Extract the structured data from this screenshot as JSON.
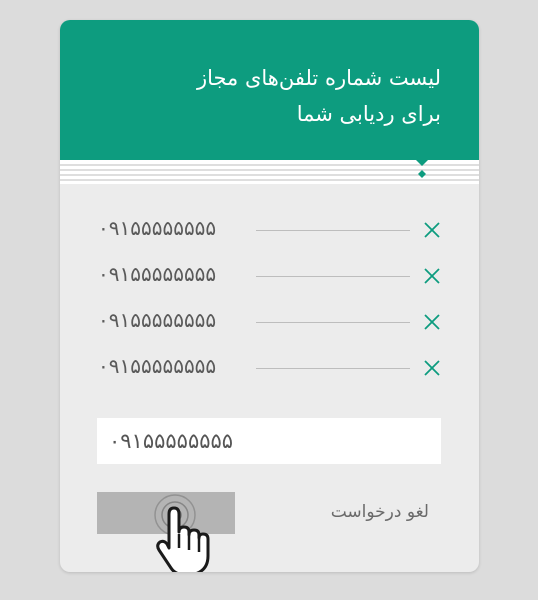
{
  "header": {
    "title_line1": "لیست شماره تلفن‌های مجاز",
    "title_line2": "برای ردیابی شما",
    "background": "#0d9c7f"
  },
  "numbers": [
    {
      "value": "۰۹۱۵۵۵۵۵۵۵۵",
      "delete_icon": "close-icon"
    },
    {
      "value": "۰۹۱۵۵۵۵۵۵۵۵",
      "delete_icon": "close-icon"
    },
    {
      "value": "۰۹۱۵۵۵۵۵۵۵۵",
      "delete_icon": "close-icon"
    },
    {
      "value": "۰۹۱۵۵۵۵۵۵۵۵",
      "delete_icon": "close-icon"
    }
  ],
  "input": {
    "value": "۰۹۱۵۵۵۵۵۵۵۵"
  },
  "actions": {
    "cancel_label": "لغو درخواست",
    "submit_label": ""
  },
  "colors": {
    "accent": "#0d9c7f",
    "card": "#ececec",
    "page": "#dcdcdc"
  },
  "cursor_icon": "hand-pointer-icon"
}
